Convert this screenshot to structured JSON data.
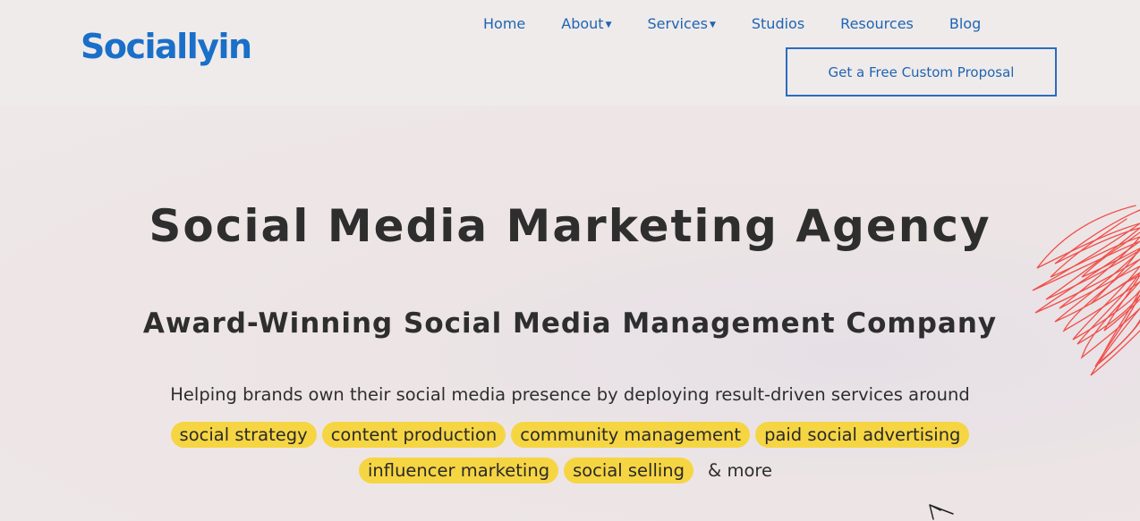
{
  "brand": {
    "logo_text": "Sociallyin",
    "brand_color": "#1a6fc9"
  },
  "nav": {
    "items": [
      {
        "label": "Home",
        "has_dropdown": false
      },
      {
        "label": "About",
        "has_dropdown": true
      },
      {
        "label": "Services",
        "has_dropdown": true
      },
      {
        "label": "Studios",
        "has_dropdown": false
      },
      {
        "label": "Resources",
        "has_dropdown": false
      },
      {
        "label": "Blog",
        "has_dropdown": false
      }
    ],
    "cta_label": "Get a Free Custom Proposal"
  },
  "hero": {
    "title": "Social Media Marketing Agency",
    "subtitle": "Award-Winning Social Media Management Company",
    "description": "Helping brands own their social media presence by deploying result-driven services around",
    "tags": [
      "social strategy",
      "content production",
      "community management",
      "paid social advertising",
      "influencer marketing",
      "social selling"
    ],
    "more_text": "& more"
  },
  "colors": {
    "tag_bg": "#f6d543",
    "nav_text": "#1f64b4",
    "scribble": "#ef4f4a"
  }
}
